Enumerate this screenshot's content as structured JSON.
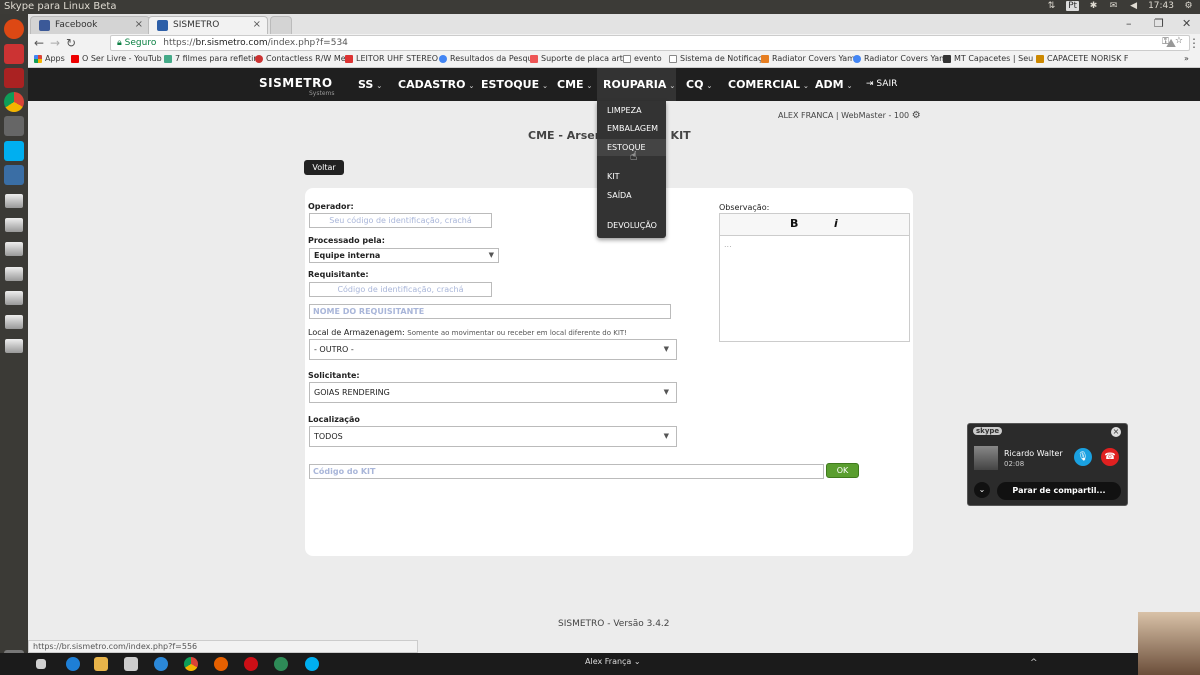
{
  "os": {
    "title": "Skype para Linux Beta",
    "clock": "17:43",
    "keyboard": "Pt"
  },
  "browser": {
    "tabs": [
      {
        "label": "Facebook"
      },
      {
        "label": "SISMETRO"
      }
    ],
    "secure_label": "Seguro",
    "url_prefix": "https://",
    "url_host": "br.sismetro.com",
    "url_path": "/index.php?f=534",
    "bookmarks": [
      "Apps",
      "O Ser Livre - YouTub",
      "7 filmes para refletir",
      "Contactless R/W Me",
      "LEITOR UHF STEREO",
      "Resultados da Pesqu",
      "Suporte de placa arti",
      "evento",
      "Sistema de Notificaç",
      "Radiator Covers Yam",
      "Radiator Covers Yam",
      "MT Capacetes | Seu",
      "CAPACETE NORISK F"
    ],
    "status_url": "https://br.sismetro.com/index.php?f=556"
  },
  "app": {
    "logo": "SISMETRO",
    "logo_sub": "Systems",
    "nav": [
      "SS",
      "CADASTRO",
      "ESTOQUE",
      "CME",
      "ROUPARIA",
      "CQ",
      "COMERCIAL",
      "ADM"
    ],
    "logout": "SAIR",
    "dropdown": [
      "LIMPEZA",
      "EMBALAGEM",
      "ESTOQUE",
      "KIT",
      "SAÍDA",
      "DEVOLUÇÃO"
    ],
    "user_line": "ALEX FRANCA | WebMaster - 100",
    "page_title_left": "CME - Arsen",
    "page_title_right": "KIT",
    "back_button": "Voltar",
    "form": {
      "operador_label": "Operador:",
      "operador_placeholder": "Seu código de identificação, crachá",
      "processado_label": "Processado pela:",
      "processado_value": "Equipe interna",
      "requisitante_label": "Requisitante:",
      "requisitante_placeholder": "Código de identificação, crachá",
      "nome_placeholder": "NOME DO REQUISITANTE",
      "local_label": "Local de Armazenagem:",
      "local_note": "Somente ao movimentar ou receber em local diferente do KIT!",
      "local_value": "- OUTRO -",
      "solicitante_label": "Solicitante:",
      "solicitante_value": "GOIAS RENDERING",
      "localizacao_label": "Localização",
      "localizacao_value": "TODOS",
      "kit_placeholder": "Código do KIT",
      "ok_label": "OK",
      "obs_label": "Observação:",
      "obs_bold": "B",
      "obs_italic": "i",
      "obs_text": "..."
    },
    "footer": "SISMETRO - Versão 3.4.2"
  },
  "skype": {
    "logo": "skype",
    "caller": "Ricardo Walter",
    "duration": "02:08",
    "share_button": "Parar de compartil..."
  },
  "taskbar": {
    "user": "Alex França"
  },
  "colors": {
    "nav_bg": "#1f1f1f",
    "ok_green": "#5a9e2f",
    "hangup_red": "#e02020",
    "mic_blue": "#1aa1e1"
  }
}
